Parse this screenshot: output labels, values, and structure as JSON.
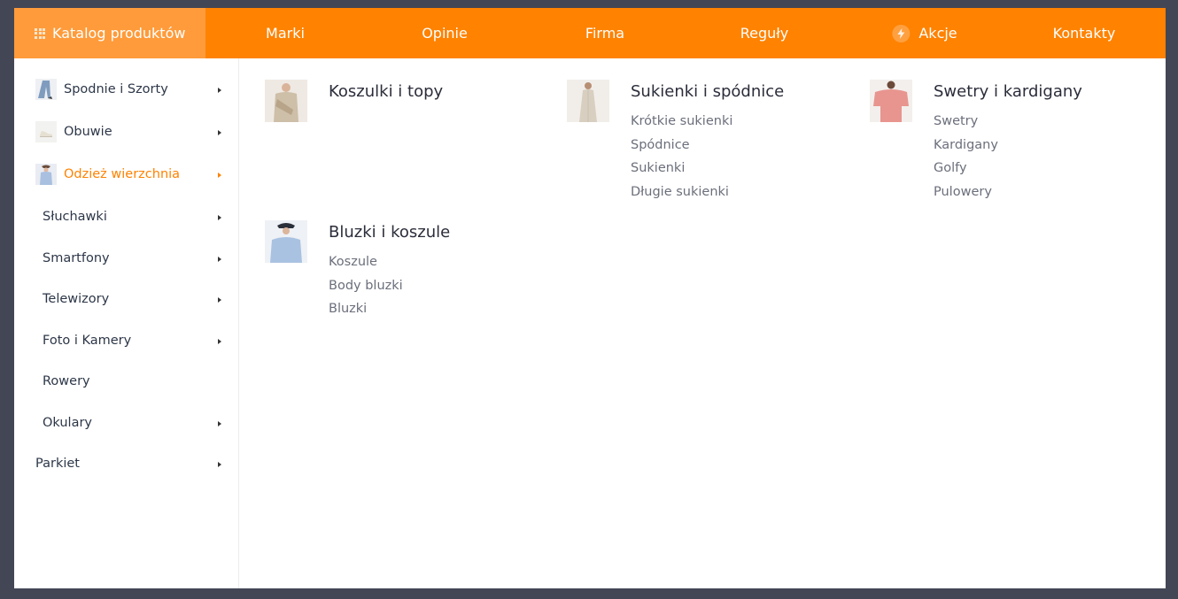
{
  "nav": {
    "catalog_label": "Katalog produktów",
    "items": [
      "Marki",
      "Opinie",
      "Firma",
      "Reguły",
      "Akcje",
      "Kontakty"
    ]
  },
  "colors": {
    "accent": "#ff8200",
    "accent_light": "#ff9b3a",
    "frame": "#434655"
  },
  "sidebar": {
    "items": [
      {
        "label": "Spodnie i Szorty",
        "icon": "pants-thumbnail",
        "has_arrow": true
      },
      {
        "label": "Obuwie",
        "icon": "shoes-thumbnail",
        "has_arrow": true
      },
      {
        "label": "Odzież wierzchnia",
        "icon": "outerwear-thumbnail",
        "has_arrow": true,
        "active": true
      },
      {
        "label": "Słuchawki",
        "has_arrow": true
      },
      {
        "label": "Smartfony",
        "has_arrow": true
      },
      {
        "label": "Telewizory",
        "has_arrow": true
      },
      {
        "label": "Foto i Kamery",
        "has_arrow": true
      },
      {
        "label": "Rowery",
        "has_arrow": false
      },
      {
        "label": "Okulary",
        "has_arrow": true
      },
      {
        "label": "Parkiet",
        "has_arrow": true
      }
    ]
  },
  "categories": [
    {
      "title": "Koszulki i topy",
      "links": []
    },
    {
      "title": "Sukienki i spódnice",
      "links": [
        "Krótkie sukienki",
        "Spódnice",
        "Sukienki",
        "Długie sukienki"
      ]
    },
    {
      "title": "Swetry i kardigany",
      "links": [
        "Swetry",
        "Kardigany",
        "Golfy",
        "Pulowery"
      ]
    },
    {
      "title": "Bluzki i koszule",
      "links": [
        "Koszule",
        "Body bluzki",
        "Bluzki"
      ]
    }
  ]
}
